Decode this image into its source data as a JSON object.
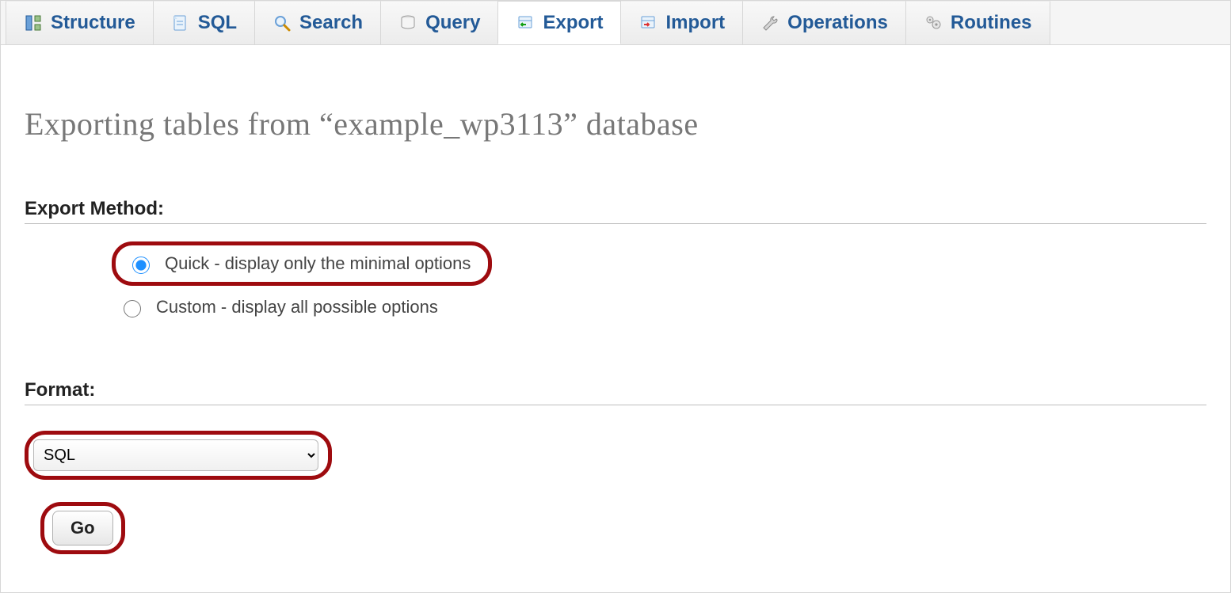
{
  "tabs": {
    "structure": {
      "label": "Structure"
    },
    "sql": {
      "label": "SQL"
    },
    "search": {
      "label": "Search"
    },
    "query": {
      "label": "Query"
    },
    "export": {
      "label": "Export"
    },
    "import": {
      "label": "Import"
    },
    "operations": {
      "label": "Operations"
    },
    "routines": {
      "label": "Routines"
    }
  },
  "active_tab": "export",
  "page_title": "Exporting tables from “example_wp3113” database",
  "export_method": {
    "heading": "Export Method:",
    "quick_label": "Quick - display only the minimal options",
    "custom_label": "Custom - display all possible options",
    "selected": "quick"
  },
  "format": {
    "heading": "Format:",
    "selected": "SQL"
  },
  "go_button": "Go"
}
